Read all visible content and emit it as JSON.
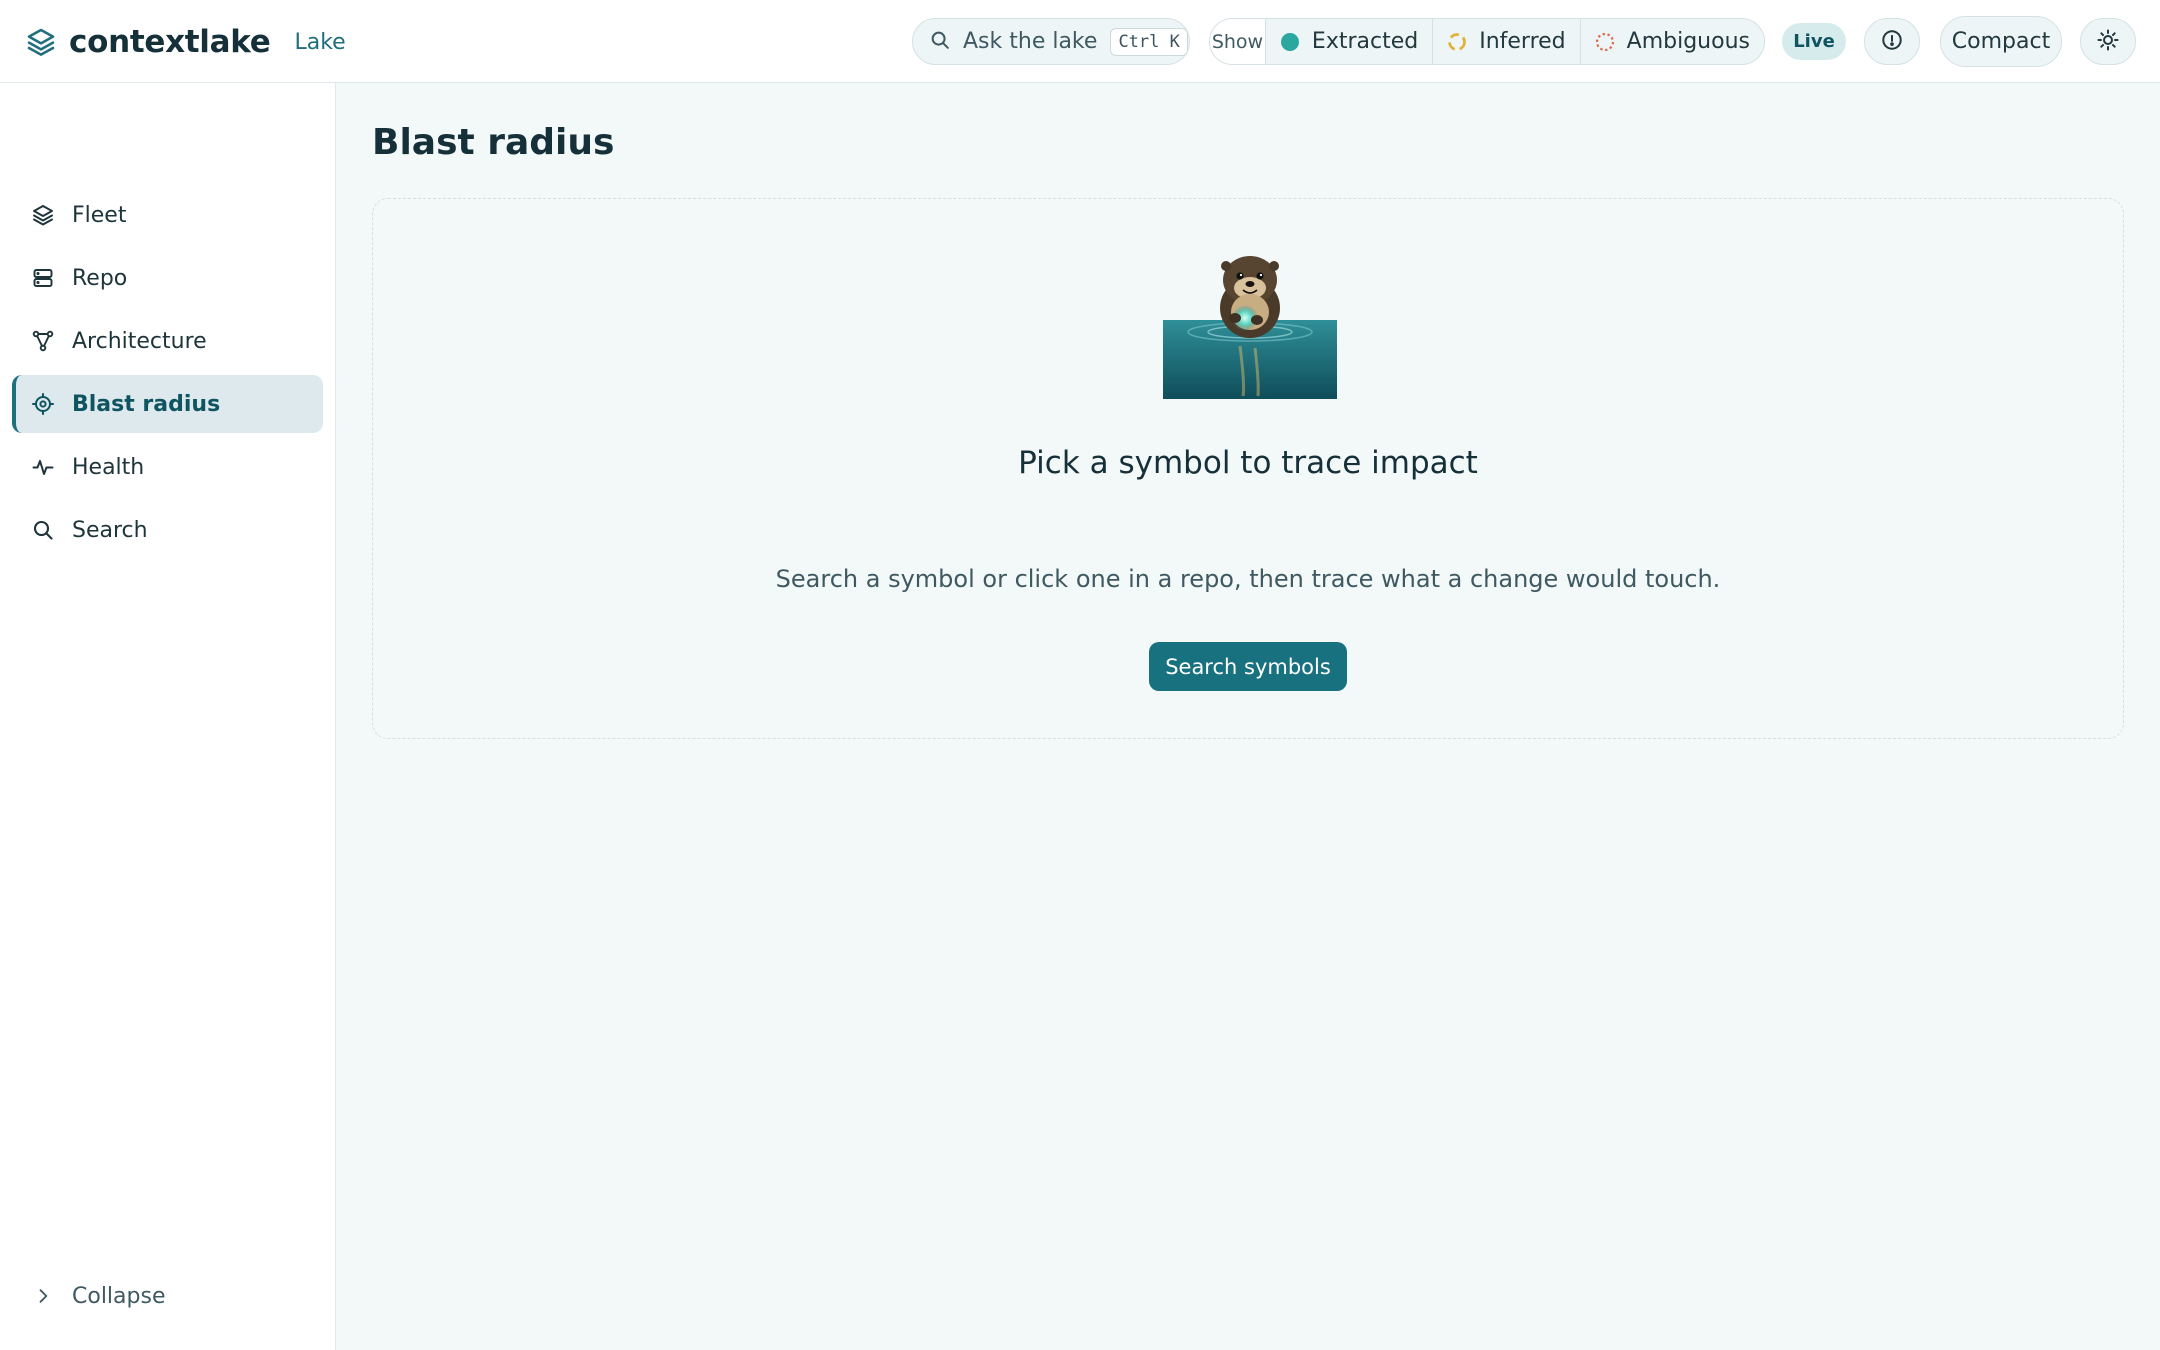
{
  "app": {
    "name": "contextlake",
    "section": "Lake"
  },
  "header": {
    "ask": {
      "label": "Ask the lake",
      "shortcut": "Ctrl K"
    },
    "show": {
      "label": "Show",
      "filters": [
        {
          "label": "Extracted",
          "color": "#2aa8a0"
        },
        {
          "label": "Inferred",
          "color": "#e0b23a"
        },
        {
          "label": "Ambiguous",
          "color": "#e06a4a"
        }
      ]
    },
    "live_label": "Live",
    "compact_label": "Compact"
  },
  "sidebar": {
    "items": [
      {
        "label": "Fleet",
        "icon": "layers-icon"
      },
      {
        "label": "Repo",
        "icon": "server-icon"
      },
      {
        "label": "Architecture",
        "icon": "graph-icon"
      },
      {
        "label": "Blast radius",
        "icon": "target-icon",
        "active": true
      },
      {
        "label": "Health",
        "icon": "pulse-icon"
      },
      {
        "label": "Search",
        "icon": "search-icon"
      }
    ],
    "collapse_label": "Collapse"
  },
  "main": {
    "title": "Blast radius",
    "empty": {
      "title": "Pick a symbol to trace impact",
      "description": "Search a symbol or click one in a repo, then trace what a change would touch.",
      "button_label": "Search symbols"
    }
  },
  "colors": {
    "accent": "#17717f",
    "background": "#f3f8f8"
  }
}
